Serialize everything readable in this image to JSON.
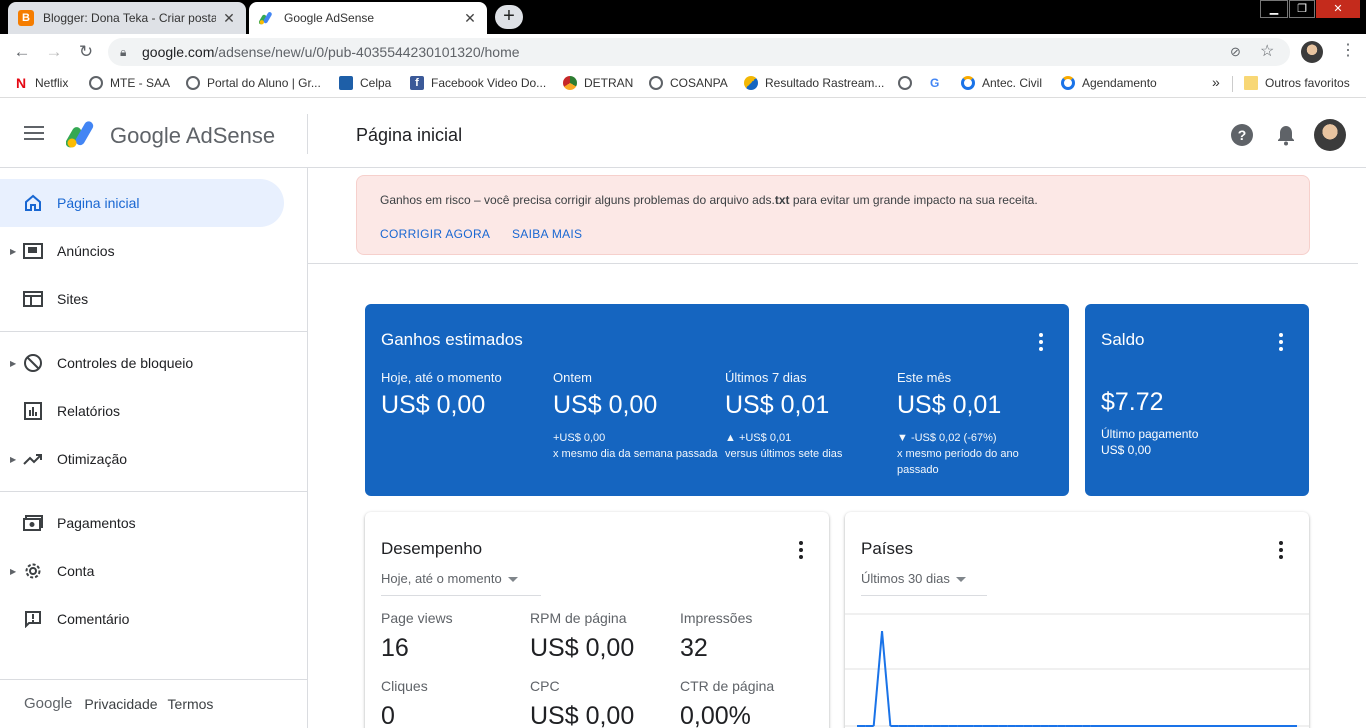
{
  "browser": {
    "tabs": [
      {
        "title": "Blogger: Dona Teka - Criar postagem",
        "favicon_color": "#f57d00",
        "active": false
      },
      {
        "title": "Google AdSense",
        "active": true
      }
    ],
    "new_tab": "+",
    "url_host": "google.com",
    "url_path": "/adsense/new/u/0/pub-4035544230101320/home",
    "bookmarks": [
      {
        "label": "Netflix",
        "icon": "netflix-icon",
        "color": "#e50914"
      },
      {
        "label": "MTE - SAA",
        "icon": "globe-icon",
        "color": "#5f6368"
      },
      {
        "label": "Portal do Aluno | Gr...",
        "icon": "globe-icon",
        "color": "#5f6368"
      },
      {
        "label": "Celpa",
        "icon": "celpa-icon",
        "color": "#1e5fa8"
      },
      {
        "label": "Facebook Video Do...",
        "icon": "facebook-icon",
        "color": "#3b5998"
      },
      {
        "label": "DETRAN",
        "icon": "detran-icon",
        "color": "#2e7d32"
      },
      {
        "label": "COSANPA",
        "icon": "globe-icon",
        "color": "#5f6368"
      },
      {
        "label": "Resultado Rastream...",
        "icon": "rastreamento-icon",
        "color": "#f2b705"
      },
      {
        "label": "",
        "icon": "globe-icon",
        "color": "#5f6368"
      },
      {
        "label": "",
        "icon": "google-icon",
        "color": "#4285f4"
      },
      {
        "label": "Antec. Civil",
        "icon": "antec-icon",
        "color": "#1a73e8"
      },
      {
        "label": "Agendamento",
        "icon": "agendamento-icon",
        "color": "#1a73e8"
      }
    ],
    "more_bookmarks": "»",
    "other_favorites": "Outros favoritos"
  },
  "header": {
    "brand": "Google AdSense",
    "page_title": "Página inicial"
  },
  "sidebar": {
    "items": [
      {
        "label": "Página inicial",
        "icon": "home-icon",
        "active": true
      },
      {
        "label": "Anúncios",
        "icon": "ads-icon",
        "expandable": true
      },
      {
        "label": "Sites",
        "icon": "sites-icon"
      },
      {
        "label": "Controles de bloqueio",
        "icon": "block-icon",
        "expandable": true
      },
      {
        "label": "Relatórios",
        "icon": "reports-icon"
      },
      {
        "label": "Otimização",
        "icon": "optimization-icon",
        "expandable": true
      },
      {
        "label": "Pagamentos",
        "icon": "payments-icon"
      },
      {
        "label": "Conta",
        "icon": "gear-icon",
        "expandable": true
      },
      {
        "label": "Comentário",
        "icon": "feedback-icon"
      }
    ],
    "footer": {
      "google": "Google",
      "privacy": "Privacidade",
      "terms": "Termos"
    }
  },
  "alert": {
    "message_before": "Ganhos em risco – você precisa corrigir alguns problemas do arquivo ads.",
    "message_bold": "txt",
    "message_after": " para evitar um grande impacto na sua receita.",
    "fix_now": "CORRIGIR AGORA",
    "learn_more": "SAIBA MAIS"
  },
  "earnings": {
    "title": "Ganhos estimados",
    "metrics": [
      {
        "label": "Hoje, até o momento",
        "value": "US$ 0,00",
        "compare": ""
      },
      {
        "label": "Ontem",
        "value": "US$ 0,00",
        "compare": "+US$ 0,00\nx mesmo dia da semana passada"
      },
      {
        "label": "Últimos 7 dias",
        "value": "US$ 0,01",
        "compare": "▲ +US$ 0,01\nversus últimos sete dias"
      },
      {
        "label": "Este mês",
        "value": "US$ 0,01",
        "compare": "▼ -US$ 0,02 (-67%)\nx mesmo período do ano passado"
      }
    ]
  },
  "balance": {
    "title": "Saldo",
    "value": "$7.72",
    "last_payment_label": "Último pagamento",
    "last_payment_value": "US$ 0,00"
  },
  "performance": {
    "title": "Desempenho",
    "range": "Hoje, até o momento",
    "metrics": [
      {
        "label": "Page views",
        "value": "16"
      },
      {
        "label": "RPM de página",
        "value": "US$ 0,00"
      },
      {
        "label": "Impressões",
        "value": "32"
      },
      {
        "label": "Cliques",
        "value": "0"
      },
      {
        "label": "CPC",
        "value": "US$ 0,00"
      },
      {
        "label": "CTR de página",
        "value": "0,00%"
      }
    ]
  },
  "countries": {
    "title": "Países",
    "range": "Últimos 30 dias"
  },
  "chart_data": {
    "type": "line",
    "x": [
      1,
      2,
      3,
      4,
      5,
      6,
      7,
      8,
      9,
      10,
      11,
      12,
      13,
      14,
      15,
      16,
      17,
      18,
      19,
      20,
      21,
      22,
      23,
      24,
      25,
      26,
      27,
      28,
      29,
      30
    ],
    "series": [
      {
        "values": [
          0,
          0,
          0,
          0.93,
          0,
          0,
          0,
          0,
          0,
          0,
          0,
          0,
          0,
          0,
          0,
          0,
          0,
          0,
          0,
          0,
          0,
          0,
          0,
          0,
          0,
          0,
          0,
          0,
          0,
          0
        ]
      }
    ],
    "ylim": [
      0,
      1
    ],
    "grid": true,
    "color": "#1a73e8"
  }
}
